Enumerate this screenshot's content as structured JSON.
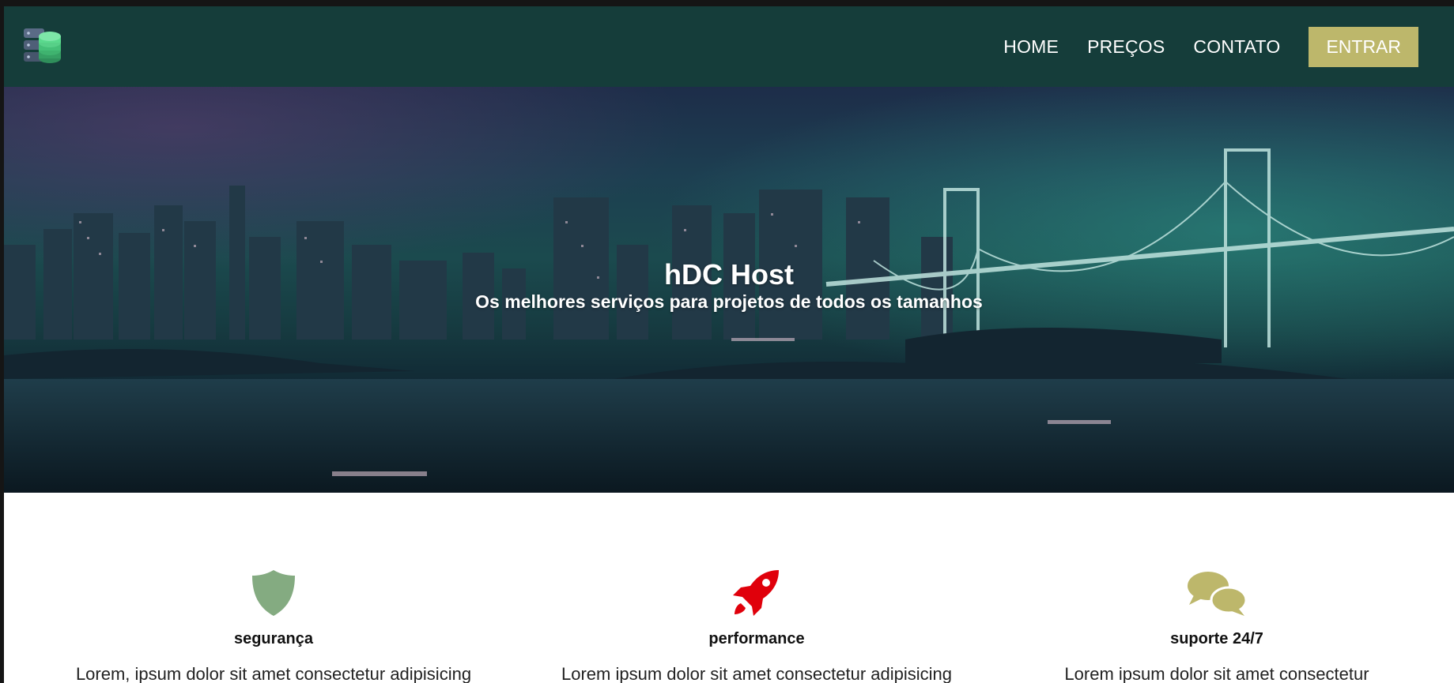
{
  "brand": {
    "logo_icon": "database-server-icon",
    "colors": {
      "navbar_bg": "#153d3a",
      "cta_bg": "#bdb76b",
      "security_icon": "#84ab81",
      "performance_icon": "#e0000b",
      "support_icon": "#bdb76b"
    }
  },
  "nav": {
    "links": [
      "HOME",
      "PREÇOS",
      "CONTATO"
    ],
    "cta_label": "ENTRAR"
  },
  "hero": {
    "title": "hDC Host",
    "subtitle": "Os melhores serviços para projetos de todos os tamanhos"
  },
  "features": [
    {
      "icon": "shield-icon",
      "title": "segurança",
      "text": "Lorem, ipsum dolor sit amet consectetur adipisicing"
    },
    {
      "icon": "rocket-icon",
      "title": "performance",
      "text": "Lorem ipsum dolor sit amet consectetur adipisicing"
    },
    {
      "icon": "chat-bubbles-icon",
      "title": "suporte 24/7",
      "text": "Lorem ipsum dolor sit amet consectetur"
    }
  ]
}
